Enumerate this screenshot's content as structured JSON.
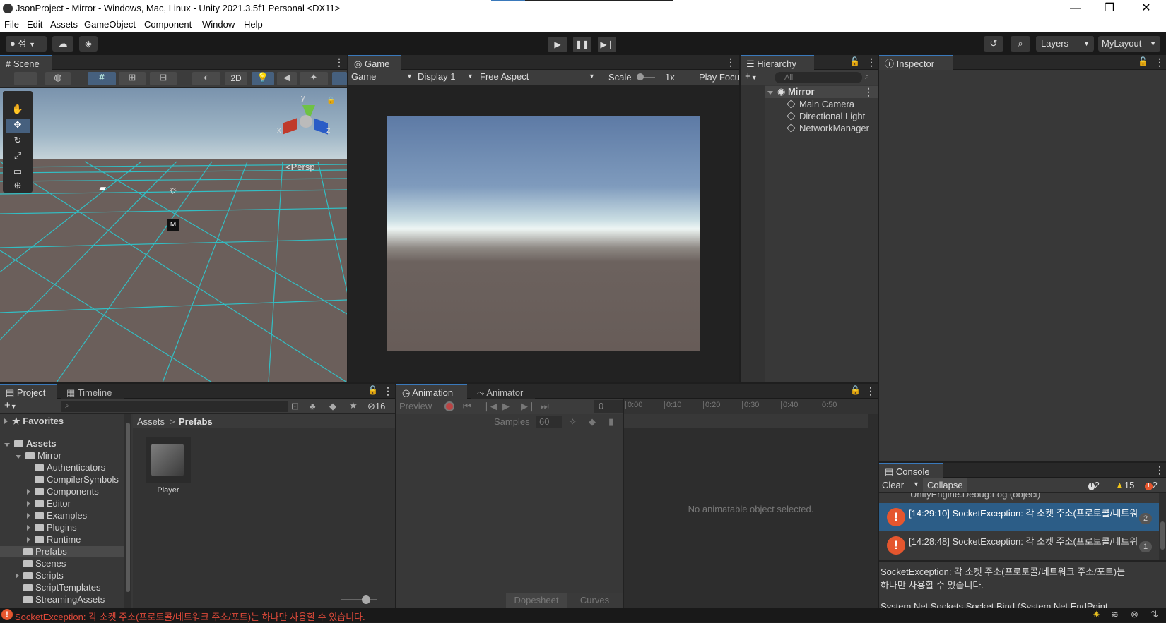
{
  "window": {
    "title": "JsonProject - Mirror - Windows, Mac, Linux - Unity 2021.3.5f1 Personal <DX11>",
    "minimize": "—",
    "maximize": "❐",
    "close": "✕"
  },
  "menu": [
    "File",
    "Edit",
    "Assets",
    "GameObject",
    "Component",
    "Window",
    "Help"
  ],
  "toolbar": {
    "account_label": "정",
    "layers_label": "Layers",
    "layout_label": "MyLayout"
  },
  "scene": {
    "tab_label": "Scene",
    "btn_2d": "2D",
    "persp_label": "Persp",
    "gizmo_x": "x",
    "gizmo_y": "y",
    "gizmo_z": "z"
  },
  "game": {
    "tab_label": "Game",
    "view_select": "Game",
    "display_select": "Display 1",
    "aspect_select": "Free Aspect",
    "scale_label": "Scale",
    "scale_value": "1x",
    "play_focused": "Play Focu"
  },
  "hierarchy": {
    "tab_label": "Hierarchy",
    "search_placeholder": "All",
    "scene_name": "Mirror",
    "items": [
      "Main Camera",
      "Directional Light",
      "NetworkManager"
    ]
  },
  "inspector": {
    "tab_label": "Inspector"
  },
  "project": {
    "tab_label": "Project",
    "timeline_tab_label": "Timeline",
    "hidden_count": "16",
    "favorites_label": "Favorites",
    "assets_label": "Assets",
    "tree": [
      {
        "label": "Mirror",
        "level": 1,
        "arrow": "open"
      },
      {
        "label": "Authenticators",
        "level": 2,
        "arrow": "none"
      },
      {
        "label": "CompilerSymbols",
        "level": 2,
        "arrow": "none"
      },
      {
        "label": "Components",
        "level": 2,
        "arrow": "closed"
      },
      {
        "label": "Editor",
        "level": 2,
        "arrow": "closed"
      },
      {
        "label": "Examples",
        "level": 2,
        "arrow": "closed"
      },
      {
        "label": "Plugins",
        "level": 2,
        "arrow": "closed"
      },
      {
        "label": "Runtime",
        "level": 2,
        "arrow": "closed"
      },
      {
        "label": "Prefabs",
        "level": 1,
        "arrow": "none",
        "selected": true
      },
      {
        "label": "Scenes",
        "level": 1,
        "arrow": "none"
      },
      {
        "label": "Scripts",
        "level": 1,
        "arrow": "closed"
      },
      {
        "label": "ScriptTemplates",
        "level": 1,
        "arrow": "none"
      },
      {
        "label": "StreamingAssets",
        "level": 1,
        "arrow": "none"
      }
    ],
    "breadcrumb_root": "Assets",
    "breadcrumb_sep": ">",
    "breadcrumb_current": "Prefabs",
    "asset_name": "Player"
  },
  "animation": {
    "tab_label": "Animation",
    "animator_tab_label": "Animator",
    "preview_label": "Preview",
    "frame_value": "0",
    "samples_label": "Samples",
    "samples_value": "60",
    "ticks": [
      "0:00",
      "0:10",
      "0:20",
      "0:30",
      "0:40",
      "0:50"
    ],
    "empty_message": "No animatable object selected.",
    "dopesheet_label": "Dopesheet",
    "curves_label": "Curves"
  },
  "console": {
    "tab_label": "Console",
    "clear_label": "Clear",
    "collapse_label": "Collapse",
    "info_count": "2",
    "warn_count": "15",
    "error_count": "2",
    "partial_top": "UnityEngine.Debug:Log (object)",
    "entries": [
      {
        "text": "[14:29:10] SocketException: 각 소켓 주소(프로토콜/네트워",
        "count": "2",
        "selected": true
      },
      {
        "text": "[14:28:48] SocketException: 각 소켓 주소(프로토콜/네트워",
        "count": "1",
        "selected": false
      }
    ],
    "detail_line1": "SocketException: 각 소켓 주소(프로토콜/네트워크 주소/포트)는",
    "detail_line2": "하나만 사용할 수 있습니다.",
    "detail_line3": "System.Net.Sockets.Socket.Bind (System.Net.EndPoint"
  },
  "statusbar": {
    "message": "SocketException: 각 소켓 주소(프로토콜/네트워크 주소/포트)는 하나만 사용할 수 있습니다."
  },
  "colors": {
    "accent_blue": "#3a79bb",
    "error_red": "#e5562e",
    "status_text_red": "#e04a3a",
    "grid_cyan": "#2cc9d0"
  }
}
